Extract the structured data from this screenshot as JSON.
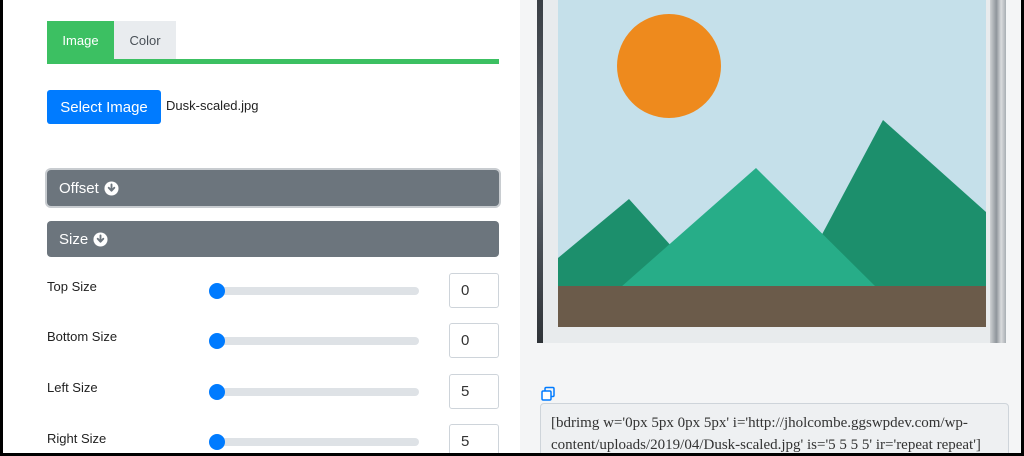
{
  "tabs": {
    "image_label": "Image",
    "color_label": "Color"
  },
  "image_picker": {
    "button_label": "Select Image",
    "filename": "Dusk-scaled.jpg"
  },
  "accordions": {
    "offset_label": "Offset",
    "size_label": "Size"
  },
  "size_settings": [
    {
      "label": "Top Size",
      "value": "0",
      "slider_fraction": 0.0
    },
    {
      "label": "Bottom Size",
      "value": "0",
      "slider_fraction": 0.0
    },
    {
      "label": "Left Size",
      "value": "5",
      "slider_fraction": 0.0
    },
    {
      "label": "Right Size",
      "value": "5",
      "slider_fraction": 0.0
    }
  ],
  "shortcode": {
    "text": "[bdrimg w='0px 5px 0px 5px' i='http://jholcombe.ggswpdev.com/wp-content/uploads/2019/04/Dusk-scaled.jpg' is='5 5 5 5' ir='repeat repeat']"
  },
  "colors": {
    "tab_active": "#3cc062",
    "primary": "#007bff",
    "accordion": "#6c757d",
    "sky": "#c5e0ea",
    "sun": "#ee8a1d",
    "mountain_dark": "#1c8f6c",
    "mountain_light": "#27ad88",
    "ground": "#6b5b4a"
  }
}
